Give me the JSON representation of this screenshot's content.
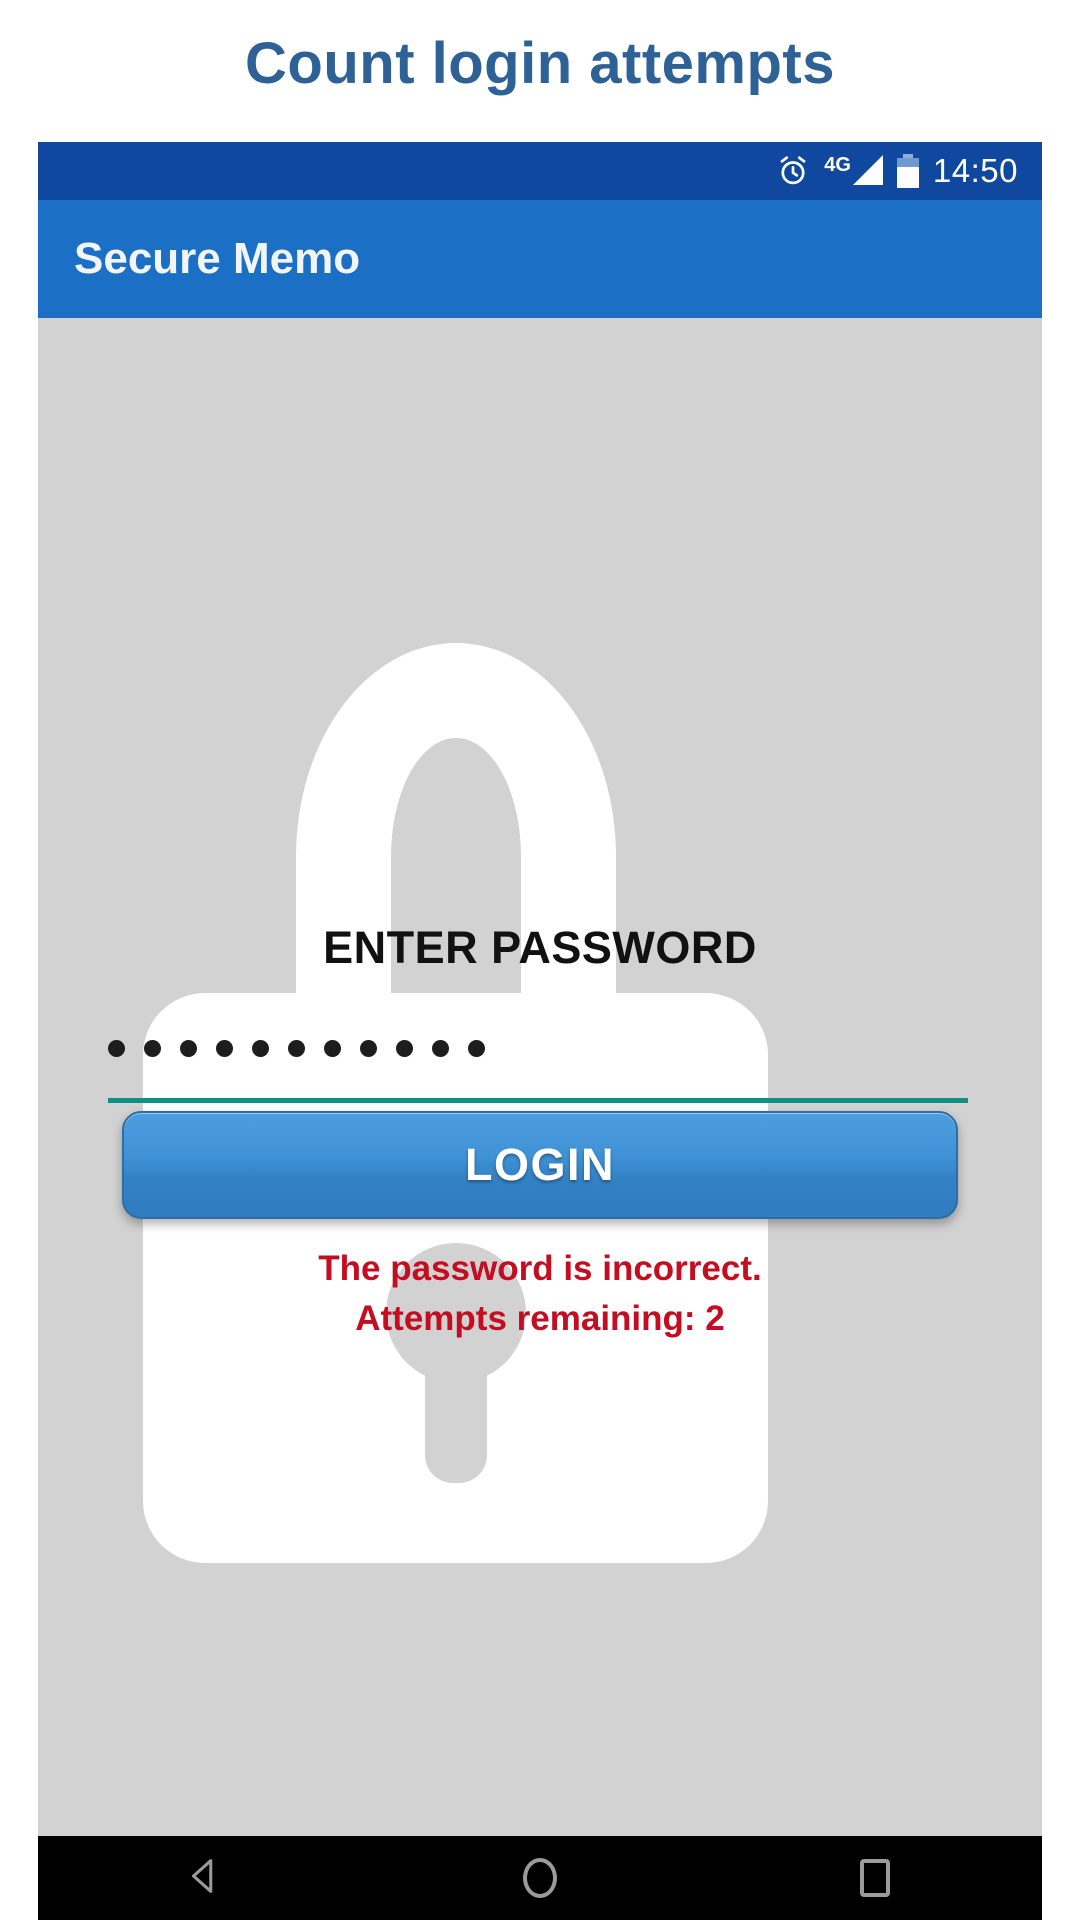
{
  "page": {
    "title": "Count login attempts"
  },
  "status_bar": {
    "alarm_icon": "alarm-icon",
    "network_label": "4G",
    "signal_icon": "signal-bars-icon",
    "battery_icon": "battery-icon",
    "time": "14:50"
  },
  "app_bar": {
    "title": "Secure Memo"
  },
  "screen": {
    "lock_watermark_icon": "padlock-icon",
    "prompt": "ENTER PASSWORD",
    "password": {
      "masked_value": "•••••••••••",
      "dot_count": 11,
      "underline_color": "#0e9082"
    },
    "login_button": {
      "label": "LOGIN"
    },
    "error": {
      "line1": "The password is incorrect.",
      "line2": "Attempts remaining: 2",
      "color": "#c40d20",
      "attempts_remaining": 2
    }
  },
  "nav_bar": {
    "back_icon": "back-triangle-icon",
    "home_icon": "home-circle-icon",
    "recents_icon": "recents-square-icon"
  },
  "colors": {
    "title": "#2e6296",
    "status_bar": "#1048a0",
    "app_bar": "#1b6fc4",
    "content_bg": "#d2d2d2",
    "accent_teal": "#0e9082",
    "button_blue": "#3f92d6",
    "error_red": "#c40d20"
  }
}
